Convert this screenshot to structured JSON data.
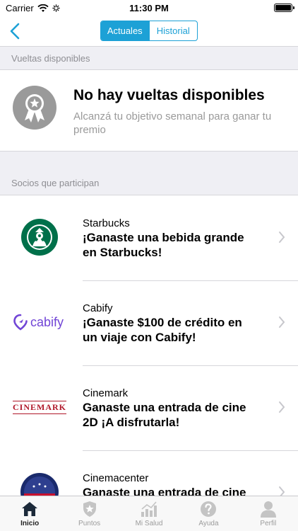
{
  "status_bar": {
    "carrier": "Carrier",
    "time": "11:30 PM"
  },
  "nav": {
    "segments": [
      "Actuales",
      "Historial"
    ],
    "active_segment": "Actuales",
    "accent_color": "#1da1d6"
  },
  "sections": {
    "available_header": "Vueltas disponibles",
    "partners_header": "Socios que participan"
  },
  "empty_state": {
    "title": "No hay vueltas disponibles",
    "subtitle": "Alcanzá tu objetivo semanal para ganar tu premio",
    "icon": "award-badge-icon"
  },
  "partners": [
    {
      "name": "Starbucks",
      "prize": "¡Ganaste una bebida grande en Starbucks!",
      "logo": "starbucks-logo"
    },
    {
      "name": "Cabify",
      "prize": "¡Ganaste $100 de crédito en un viaje con Cabify!",
      "logo": "cabify-logo",
      "logo_text": "cabify"
    },
    {
      "name": "Cinemark",
      "prize": "Ganaste una entrada de cine 2D ¡A disfrutarla!",
      "logo": "cinemark-logo",
      "logo_text": "CINEMARK"
    },
    {
      "name": "Cinemacenter",
      "prize": "Ganaste una entrada de cine",
      "logo": "cinemacenter-logo"
    }
  ],
  "tab_bar": {
    "tabs": [
      {
        "label": "Inicio",
        "icon": "home-icon",
        "active": true
      },
      {
        "label": "Puntos",
        "icon": "shield-star-icon",
        "active": false
      },
      {
        "label": "Mi Salud",
        "icon": "chart-icon",
        "active": false
      },
      {
        "label": "Ayuda",
        "icon": "question-icon",
        "active": false
      },
      {
        "label": "Perfil",
        "icon": "person-icon",
        "active": false
      }
    ]
  }
}
